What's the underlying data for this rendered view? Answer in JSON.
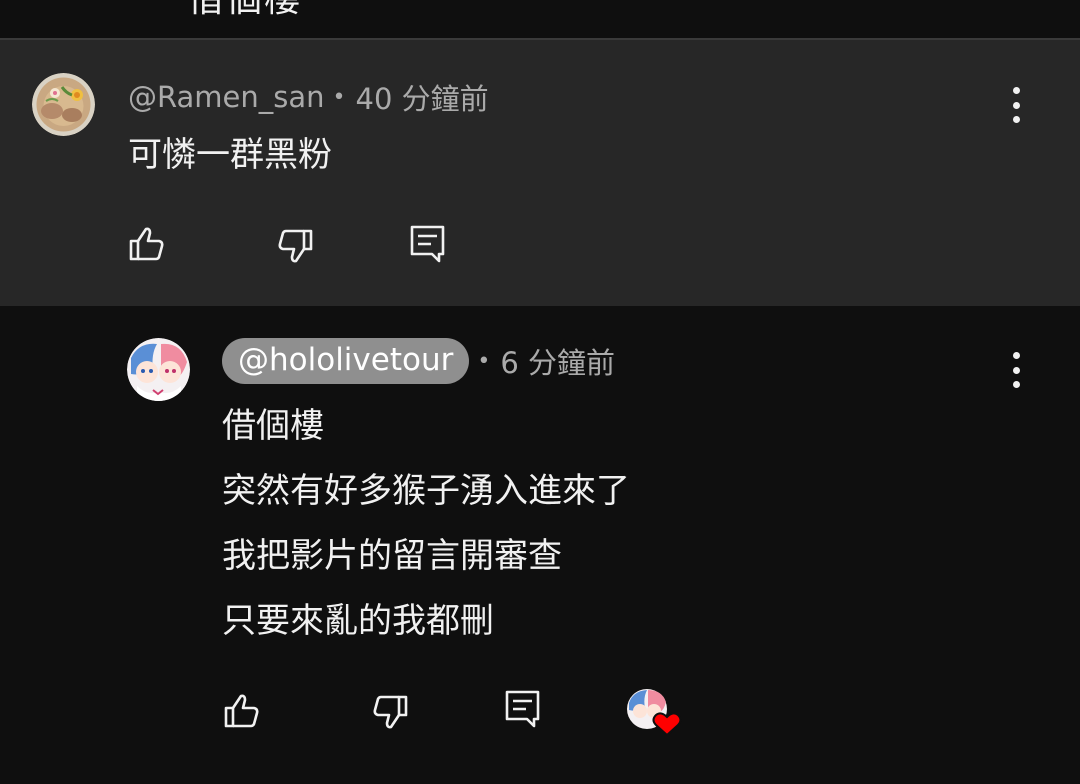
{
  "previous_comment": {
    "visible_text": "借個樓"
  },
  "comment": {
    "author": "@Ramen_san",
    "time": "40 分鐘前",
    "separator": "•",
    "body": "可憐一群黑粉"
  },
  "reply": {
    "author": "@hololivetour",
    "time": "6 分鐘前",
    "separator": "•",
    "lines": [
      "借個樓",
      "突然有好多猴子湧入進來了",
      "我把影片的留言開審查",
      "只要來亂的我都刪"
    ]
  },
  "icons": {
    "like": "thumbs-up-icon",
    "dislike": "thumbs-down-icon",
    "reply": "reply-comment-icon",
    "more": "more-vertical-icon",
    "creator_heart": "creator-heart-icon"
  },
  "colors": {
    "background": "#0f0f0f",
    "highlight_background": "#272727",
    "handle_chip": "#8f8f8f",
    "heart": "#ff0000"
  }
}
